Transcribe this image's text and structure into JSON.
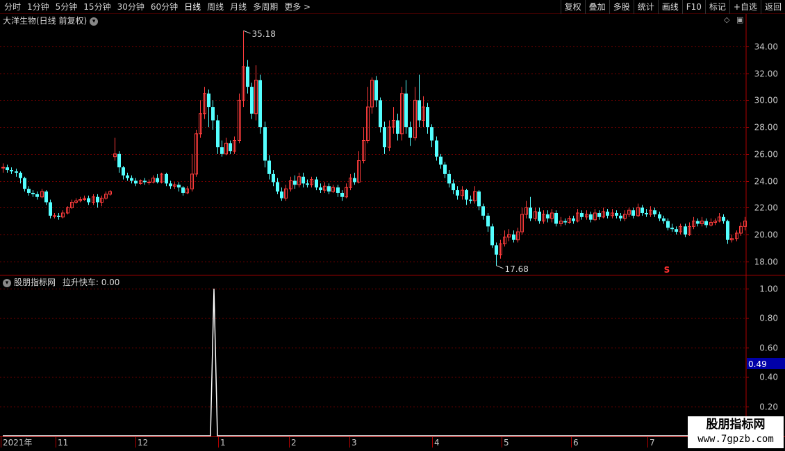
{
  "toolbar": {
    "periods": [
      "分时",
      "1分钟",
      "5分钟",
      "15分钟",
      "30分钟",
      "60分钟",
      "日线",
      "周线",
      "月线",
      "多周期",
      "更多 >"
    ],
    "active_period": "日线",
    "tools": [
      "复权",
      "叠加",
      "多股",
      "统计",
      "画线",
      "F10",
      "标记",
      "+自选",
      "返回"
    ]
  },
  "main_panel": {
    "title": "大洋生物(日线 前复权)",
    "high_label": "35.18",
    "low_label": "17.68",
    "s_marker": "S",
    "y_ticks": [
      "34.00",
      "32.00",
      "30.00",
      "28.00",
      "26.00",
      "24.00",
      "22.00",
      "20.00",
      "18.00"
    ]
  },
  "indicator_panel": {
    "title": "股朋指标网",
    "indicator_label": "拉升快车: 0.00",
    "y_ticks": [
      "1.00",
      "0.80",
      "0.60",
      "0.40",
      "0.20"
    ],
    "current_value": "0.49"
  },
  "x_axis": {
    "labels": [
      "2021年",
      "11",
      "12",
      "1",
      "2",
      "3",
      "4",
      "5",
      "6",
      "7"
    ]
  },
  "watermark": {
    "line1": "股朋指标网",
    "line2": "www.7gpzb.com"
  },
  "colors": {
    "up": "#ff3c3c",
    "down": "#54ffff",
    "grid": "#7a0000",
    "axis": "#b00000",
    "text": "#c8c8c8"
  },
  "chart_data": {
    "type": "candlestick",
    "series": [
      {
        "name": "大洋生物",
        "values": [
          [
            25.0,
            25.0,
            25.3,
            24.6
          ],
          [
            25.0,
            24.8,
            25.2,
            24.6
          ],
          [
            24.8,
            24.7,
            25.0,
            24.5
          ],
          [
            24.7,
            24.6,
            24.9,
            24.3
          ],
          [
            24.6,
            24.2,
            24.7,
            23.8
          ],
          [
            24.2,
            23.4,
            24.3,
            23.2
          ],
          [
            23.4,
            23.1,
            23.6,
            22.9
          ],
          [
            23.1,
            23.0,
            23.3,
            22.8
          ],
          [
            23.0,
            22.8,
            23.2,
            22.6
          ],
          [
            22.8,
            23.2,
            23.4,
            22.7
          ],
          [
            23.2,
            22.4,
            23.3,
            22.2
          ],
          [
            22.4,
            21.4,
            22.6,
            21.2
          ],
          [
            21.4,
            21.4,
            21.6,
            21.2
          ],
          [
            21.4,
            21.3,
            21.6,
            21.1
          ],
          [
            21.3,
            21.6,
            21.8,
            21.2
          ],
          [
            21.6,
            22.0,
            22.1,
            21.5
          ],
          [
            22.0,
            22.4,
            22.6,
            21.9
          ],
          [
            22.4,
            22.5,
            22.7,
            22.3
          ],
          [
            22.5,
            22.6,
            22.8,
            22.4
          ],
          [
            22.6,
            22.7,
            22.9,
            22.5
          ],
          [
            22.7,
            22.4,
            22.9,
            22.2
          ],
          [
            22.4,
            22.8,
            23.0,
            22.2
          ],
          [
            22.8,
            22.4,
            23.0,
            22.0
          ],
          [
            22.4,
            22.7,
            22.9,
            22.1
          ],
          [
            22.7,
            23.0,
            23.2,
            22.6
          ],
          [
            23.0,
            23.2,
            23.3,
            22.9
          ],
          [
            25.8,
            26.0,
            27.2,
            25.5
          ],
          [
            26.0,
            25.0,
            26.2,
            24.6
          ],
          [
            25.0,
            24.4,
            25.1,
            24.1
          ],
          [
            24.4,
            24.2,
            24.6,
            24.0
          ],
          [
            24.2,
            24.0,
            24.4,
            23.8
          ],
          [
            24.0,
            23.8,
            24.2,
            23.6
          ],
          [
            23.8,
            24.0,
            24.1,
            23.7
          ],
          [
            24.0,
            23.9,
            24.2,
            23.7
          ],
          [
            23.9,
            23.9,
            24.1,
            23.7
          ],
          [
            23.9,
            24.2,
            24.4,
            23.8
          ],
          [
            24.2,
            23.9,
            24.5,
            23.8
          ],
          [
            23.9,
            24.5,
            24.6,
            23.8
          ],
          [
            24.5,
            23.8,
            24.6,
            23.6
          ],
          [
            23.8,
            23.6,
            24.0,
            23.4
          ],
          [
            23.6,
            23.7,
            23.9,
            23.4
          ],
          [
            23.7,
            23.5,
            23.9,
            23.2
          ],
          [
            23.5,
            23.1,
            23.6,
            22.9
          ],
          [
            23.1,
            23.4,
            23.6,
            23.0
          ],
          [
            23.4,
            24.5,
            26.0,
            23.2
          ],
          [
            24.5,
            27.5,
            27.8,
            24.3
          ],
          [
            27.5,
            29.0,
            30.0,
            27.2
          ],
          [
            29.0,
            30.5,
            31.0,
            28.6
          ],
          [
            30.5,
            29.5,
            30.8,
            28.0
          ],
          [
            29.5,
            28.5,
            30.0,
            27.8
          ],
          [
            28.5,
            26.5,
            28.9,
            26.0
          ],
          [
            26.5,
            26.0,
            27.0,
            25.8
          ],
          [
            26.0,
            26.8,
            27.2,
            25.9
          ],
          [
            26.8,
            26.2,
            27.0,
            26.0
          ],
          [
            26.2,
            27.0,
            27.3,
            26.0
          ],
          [
            27.0,
            30.0,
            30.5,
            26.8
          ],
          [
            30.0,
            32.5,
            35.18,
            29.5
          ],
          [
            32.5,
            31.0,
            33.0,
            30.5
          ],
          [
            31.0,
            29.0,
            31.3,
            28.6
          ],
          [
            29.0,
            31.5,
            32.6,
            28.5
          ],
          [
            31.5,
            28.0,
            31.9,
            27.5
          ],
          [
            28.0,
            25.5,
            28.4,
            25.0
          ],
          [
            25.5,
            24.5,
            25.9,
            24.1
          ],
          [
            24.5,
            23.9,
            24.8,
            23.6
          ],
          [
            23.9,
            23.2,
            24.2,
            23.0
          ],
          [
            23.2,
            22.7,
            23.5,
            22.5
          ],
          [
            22.7,
            23.4,
            23.7,
            22.5
          ],
          [
            23.4,
            24.0,
            24.3,
            23.2
          ],
          [
            24.0,
            23.7,
            24.4,
            23.4
          ],
          [
            23.7,
            24.3,
            24.6,
            23.5
          ],
          [
            24.3,
            23.8,
            24.6,
            23.5
          ],
          [
            23.8,
            23.7,
            24.1,
            23.5
          ],
          [
            23.7,
            24.1,
            24.3,
            23.5
          ],
          [
            24.1,
            23.5,
            24.3,
            23.3
          ],
          [
            23.5,
            23.3,
            23.8,
            23.1
          ],
          [
            23.3,
            23.6,
            23.9,
            23.1
          ],
          [
            23.6,
            23.2,
            23.8,
            23.0
          ],
          [
            23.2,
            23.5,
            23.7,
            23.1
          ],
          [
            23.5,
            23.1,
            23.7,
            22.8
          ],
          [
            23.1,
            22.8,
            23.3,
            22.5
          ],
          [
            22.8,
            23.5,
            23.8,
            22.7
          ],
          [
            23.5,
            24.2,
            24.5,
            23.3
          ],
          [
            24.2,
            23.9,
            24.6,
            23.7
          ],
          [
            23.9,
            25.5,
            26.2,
            23.8
          ],
          [
            25.5,
            27.0,
            28.0,
            25.3
          ],
          [
            27.0,
            29.5,
            31.0,
            26.8
          ],
          [
            29.5,
            31.5,
            31.7,
            29.0
          ],
          [
            31.5,
            30.0,
            31.8,
            29.5
          ],
          [
            30.0,
            28.0,
            30.2,
            27.6
          ],
          [
            28.0,
            26.5,
            28.4,
            26.0
          ],
          [
            26.5,
            28.0,
            28.5,
            26.2
          ],
          [
            28.0,
            28.5,
            29.5,
            27.5
          ],
          [
            28.5,
            27.5,
            29.0,
            27.0
          ],
          [
            27.5,
            30.5,
            31.0,
            27.0
          ],
          [
            30.5,
            28.0,
            31.5,
            27.5
          ],
          [
            28.0,
            27.2,
            28.4,
            26.6
          ],
          [
            27.2,
            30.0,
            31.0,
            27.0
          ],
          [
            30.0,
            28.5,
            31.9,
            28.0
          ],
          [
            28.5,
            29.5,
            30.3,
            28.0
          ],
          [
            29.5,
            28.0,
            29.8,
            27.5
          ],
          [
            28.0,
            27.0,
            28.2,
            26.5
          ],
          [
            27.0,
            25.8,
            27.3,
            25.5
          ],
          [
            25.8,
            25.2,
            26.0,
            24.9
          ],
          [
            25.2,
            24.5,
            25.4,
            24.2
          ],
          [
            24.5,
            23.8,
            24.8,
            23.5
          ],
          [
            23.8,
            23.3,
            24.1,
            23.0
          ],
          [
            23.3,
            22.9,
            23.6,
            22.6
          ],
          [
            22.9,
            23.3,
            23.6,
            22.6
          ],
          [
            23.3,
            22.6,
            23.4,
            22.2
          ],
          [
            22.6,
            22.5,
            22.9,
            22.3
          ],
          [
            22.5,
            23.2,
            23.6,
            22.3
          ],
          [
            23.2,
            22.1,
            23.3,
            21.8
          ],
          [
            22.1,
            21.4,
            22.3,
            21.1
          ],
          [
            21.4,
            20.6,
            21.6,
            20.2
          ],
          [
            20.6,
            19.2,
            20.8,
            19.0
          ],
          [
            19.2,
            18.5,
            19.4,
            17.68
          ],
          [
            18.5,
            19.3,
            19.6,
            18.2
          ],
          [
            19.3,
            19.8,
            20.3,
            19.1
          ],
          [
            19.8,
            20.0,
            20.4,
            19.5
          ],
          [
            20.0,
            19.6,
            20.3,
            19.4
          ],
          [
            19.6,
            20.2,
            20.5,
            19.4
          ],
          [
            20.2,
            21.5,
            22.0,
            20.0
          ],
          [
            21.5,
            22.0,
            22.5,
            21.2
          ],
          [
            22.0,
            21.2,
            22.8,
            21.0
          ],
          [
            21.2,
            21.7,
            22.0,
            21.0
          ],
          [
            21.7,
            21.0,
            22.0,
            20.8
          ],
          [
            21.0,
            21.5,
            21.8,
            20.8
          ],
          [
            21.5,
            21.2,
            21.8,
            20.9
          ],
          [
            21.2,
            21.6,
            21.9,
            20.9
          ],
          [
            21.6,
            20.8,
            21.8,
            20.6
          ],
          [
            20.8,
            21.0,
            21.3,
            20.6
          ],
          [
            21.0,
            20.9,
            21.2,
            20.7
          ],
          [
            20.9,
            21.2,
            21.4,
            20.8
          ],
          [
            21.2,
            21.0,
            21.4,
            20.8
          ],
          [
            21.0,
            21.6,
            21.9,
            20.9
          ],
          [
            21.6,
            21.3,
            21.8,
            21.1
          ],
          [
            21.3,
            21.5,
            21.8,
            21.1
          ],
          [
            21.5,
            21.1,
            21.7,
            20.9
          ],
          [
            21.1,
            21.6,
            21.9,
            21.0
          ],
          [
            21.6,
            21.3,
            21.8,
            21.1
          ],
          [
            21.3,
            21.7,
            22.0,
            21.2
          ],
          [
            21.7,
            21.4,
            21.9,
            21.2
          ],
          [
            21.4,
            21.6,
            21.9,
            21.2
          ],
          [
            21.6,
            21.4,
            21.8,
            21.2
          ],
          [
            21.4,
            21.2,
            21.6,
            21.0
          ],
          [
            21.2,
            21.5,
            21.8,
            21.0
          ],
          [
            21.5,
            21.8,
            22.0,
            21.3
          ],
          [
            21.8,
            21.4,
            22.0,
            21.2
          ],
          [
            21.4,
            22.0,
            22.3,
            21.3
          ],
          [
            22.0,
            21.6,
            22.2,
            21.4
          ],
          [
            21.6,
            21.5,
            21.9,
            21.3
          ],
          [
            21.5,
            21.8,
            22.1,
            21.3
          ],
          [
            21.8,
            21.5,
            22.0,
            21.3
          ],
          [
            21.5,
            21.2,
            21.7,
            21.0
          ],
          [
            21.2,
            21.0,
            21.4,
            20.8
          ],
          [
            21.0,
            20.5,
            21.2,
            20.3
          ],
          [
            20.5,
            20.4,
            20.8,
            20.2
          ],
          [
            20.4,
            20.2,
            20.6,
            20.0
          ],
          [
            20.2,
            20.6,
            20.8,
            20.0
          ],
          [
            20.6,
            20.0,
            20.8,
            19.8
          ],
          [
            20.0,
            20.6,
            20.9,
            19.9
          ],
          [
            20.6,
            21.0,
            21.3,
            20.4
          ],
          [
            21.0,
            20.8,
            21.2,
            20.6
          ],
          [
            20.8,
            21.0,
            21.3,
            20.6
          ],
          [
            21.0,
            20.7,
            21.2,
            20.5
          ],
          [
            20.7,
            20.9,
            21.2,
            20.6
          ],
          [
            20.9,
            21.0,
            21.2,
            20.7
          ],
          [
            21.0,
            21.3,
            21.6,
            20.9
          ],
          [
            21.3,
            21.0,
            21.5,
            20.8
          ],
          [
            21.0,
            19.6,
            21.1,
            19.3
          ],
          [
            19.6,
            19.7,
            20.0,
            19.4
          ],
          [
            19.7,
            20.1,
            20.3,
            19.5
          ],
          [
            20.1,
            20.6,
            20.9,
            19.9
          ],
          [
            20.6,
            21.0,
            21.3,
            20.3
          ]
        ]
      },
      {
        "name": "拉升快车",
        "spike_value": 1.0
      }
    ],
    "ylim": [
      17.0,
      35.5
    ],
    "indicator_ylim": [
      0.0,
      1.0
    ]
  }
}
